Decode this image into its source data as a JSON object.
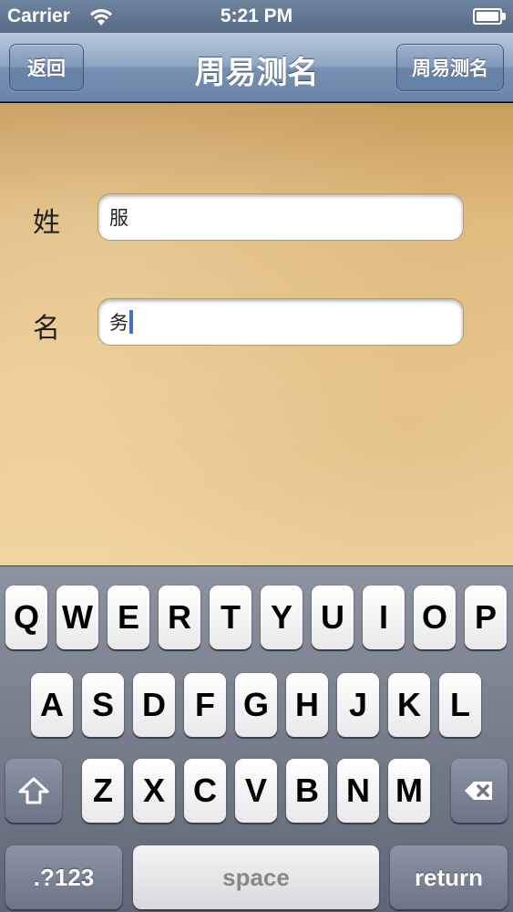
{
  "status_bar": {
    "carrier": "Carrier",
    "time": "5:21 PM"
  },
  "nav": {
    "back_label": "返回",
    "title": "周易测名",
    "right_label": "周易测名"
  },
  "form": {
    "surname_label": "姓",
    "surname_value": "服",
    "given_label": "名",
    "given_value": "务"
  },
  "keyboard": {
    "row1": [
      "Q",
      "W",
      "E",
      "R",
      "T",
      "Y",
      "U",
      "I",
      "O",
      "P"
    ],
    "row2": [
      "A",
      "S",
      "D",
      "F",
      "G",
      "H",
      "J",
      "K",
      "L"
    ],
    "row3": [
      "Z",
      "X",
      "C",
      "V",
      "B",
      "N",
      "M"
    ],
    "numbers_label": ".?123",
    "space_label": "space",
    "return_label": "return",
    "shift_icon": "shift-arrow-icon",
    "delete_icon": "backspace-icon"
  },
  "colors": {
    "cursor": "#3d6fe3",
    "nav_blue": "#7891b2",
    "parchment": "#edcd94"
  }
}
